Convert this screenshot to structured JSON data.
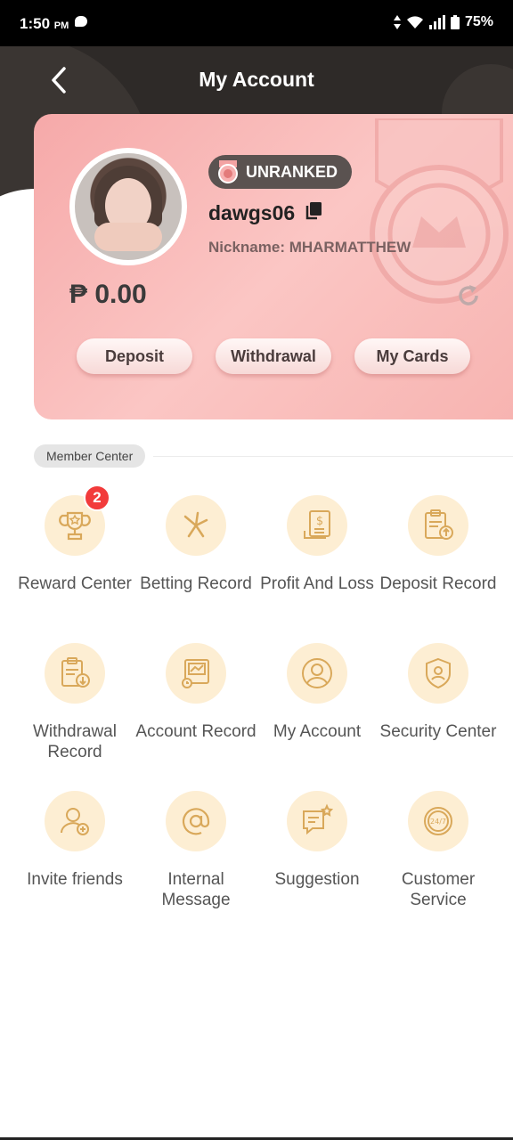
{
  "status_bar": {
    "time": "1:50",
    "ampm": "PM",
    "battery": "75%"
  },
  "header": {
    "title": "My Account"
  },
  "profile": {
    "rank": "UNRANKED",
    "username": "dawgs06",
    "nickname": "Nickname: MHARMATTHEW",
    "balance": "₱ 0.00",
    "buttons": {
      "deposit": "Deposit",
      "withdrawal": "Withdrawal",
      "my_cards": "My Cards"
    }
  },
  "member_center": {
    "title": "Member Center",
    "items": [
      {
        "label": "Reward Center",
        "icon": "trophy-icon",
        "badge": "2"
      },
      {
        "label": "Betting Record",
        "icon": "betting-icon"
      },
      {
        "label": "Profit And Loss",
        "icon": "document-dollar-icon"
      },
      {
        "label": "Deposit Record",
        "icon": "clipboard-upload-icon"
      },
      {
        "label": "Withdrawal Record",
        "icon": "clipboard-download-icon"
      },
      {
        "label": "Account Record",
        "icon": "account-record-icon"
      },
      {
        "label": "My Account",
        "icon": "user-icon"
      },
      {
        "label": "Security Center",
        "icon": "shield-icon"
      },
      {
        "label": "Invite friends",
        "icon": "user-add-icon"
      },
      {
        "label": "Internal Message",
        "icon": "at-icon"
      },
      {
        "label": "Suggestion",
        "icon": "chat-star-icon"
      },
      {
        "label": "Customer Service",
        "icon": "support-24-7-icon"
      }
    ]
  },
  "colors": {
    "header_bg": "#2e2a28",
    "card_pink": "#f6a9a9",
    "icon_bg": "#fdeed3",
    "icon_stroke": "#d9a85a",
    "badge_red": "#f23b3b"
  }
}
